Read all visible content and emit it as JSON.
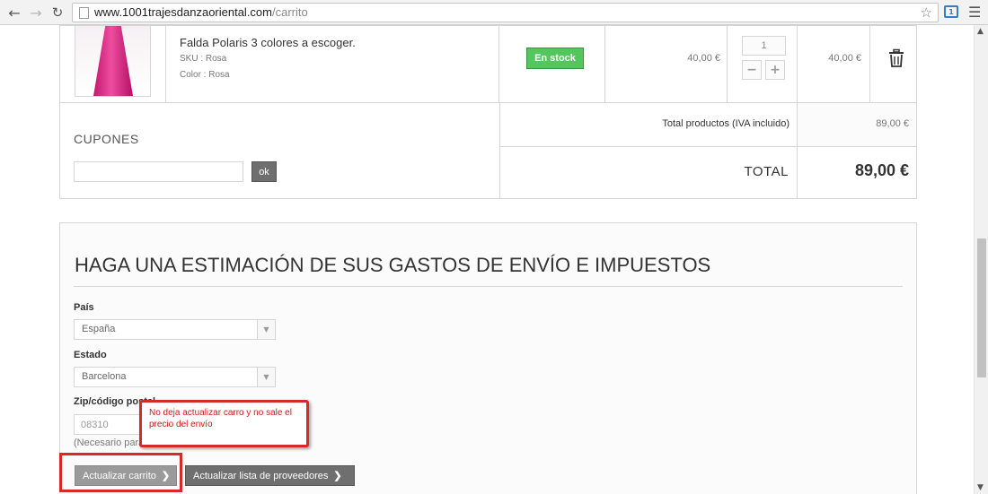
{
  "browser": {
    "url_host": "www.1001trajesdanzaoriental.com",
    "url_path": "/carrito",
    "icons": {
      "back": "back-arrow-icon",
      "forward": "forward-arrow-icon",
      "reload": "reload-icon",
      "bookmark": "star-icon",
      "extension": "extension-icon",
      "menu": "hamburger-menu-icon"
    },
    "extension_badge": "1"
  },
  "cart": {
    "product": {
      "name": "Falda Polaris 3 colores a escoger.",
      "sku": "SKU : Rosa",
      "color": "Color : Rosa",
      "availability": "En stock",
      "unit_price": "40,00 €",
      "quantity": "1",
      "qty_minus": "−",
      "qty_plus": "+",
      "line_total": "40,00 €"
    },
    "coupons": {
      "title": "CUPONES",
      "input_value": "",
      "ok_label": "ok"
    },
    "totals": {
      "products_label": "Total productos (IVA incluido)",
      "products_value": "89,00 €",
      "total_label": "TOTAL",
      "total_value": "89,00 €"
    }
  },
  "shipping": {
    "title": "HAGA UNA ESTIMACIÓN DE SUS GASTOS DE ENVÍO E IMPUESTOS",
    "country_label": "País",
    "country_value": "España",
    "state_label": "Estado",
    "state_value": "Barcelona",
    "zip_label": "Zip/código postal",
    "zip_value": "08310",
    "zip_note": "(Necesario para",
    "update_cart_label": "Actualizar carrito",
    "update_providers_label": "Actualizar lista de proveedores"
  },
  "annotation": {
    "text": "No deja actualizar carro y no sale el precio del envío",
    "color": "#d42a2a"
  },
  "colors": {
    "stock_green": "#55c65e",
    "button_grey": "#6f6f6f",
    "border": "#d6d4d4"
  }
}
